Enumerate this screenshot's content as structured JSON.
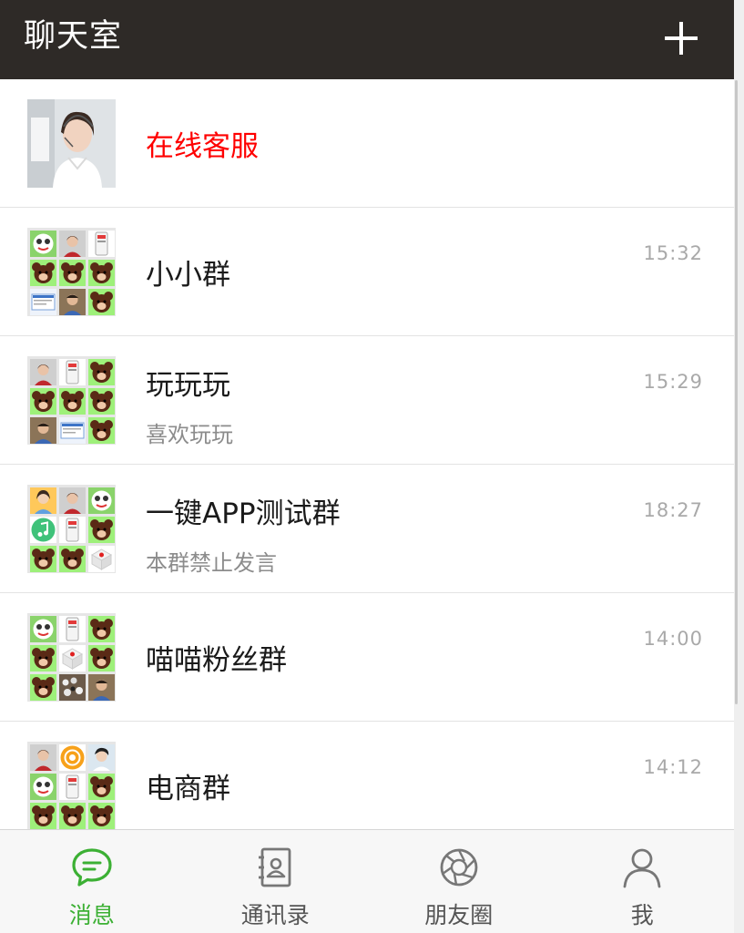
{
  "header": {
    "title": "聊天室",
    "add_icon": "plus-icon"
  },
  "colors": {
    "header_bg": "#2e2a27",
    "accent_green": "#3cb034",
    "service_red": "#ff0000",
    "time_gray": "#a9a9a9",
    "preview_gray": "#8c8c8c"
  },
  "chats": [
    {
      "name": "在线客服",
      "preview": "",
      "time": ""
    },
    {
      "name": "小小群",
      "preview": "",
      "time": "15:32"
    },
    {
      "name": "玩玩玩",
      "preview": "喜欢玩玩",
      "time": "15:29"
    },
    {
      "name": "一键APP测试群",
      "preview": "本群禁止发言",
      "time": "18:27"
    },
    {
      "name": "喵喵粉丝群",
      "preview": "",
      "time": "14:00"
    },
    {
      "name": "电商群",
      "preview": "",
      "time": "14:12"
    }
  ],
  "tabs": [
    {
      "label": "消息",
      "icon": "chat-bubble-icon",
      "active": true
    },
    {
      "label": "通讯录",
      "icon": "contacts-book-icon",
      "active": false
    },
    {
      "label": "朋友圈",
      "icon": "camera-aperture-icon",
      "active": false
    },
    {
      "label": "我",
      "icon": "person-icon",
      "active": false
    }
  ]
}
